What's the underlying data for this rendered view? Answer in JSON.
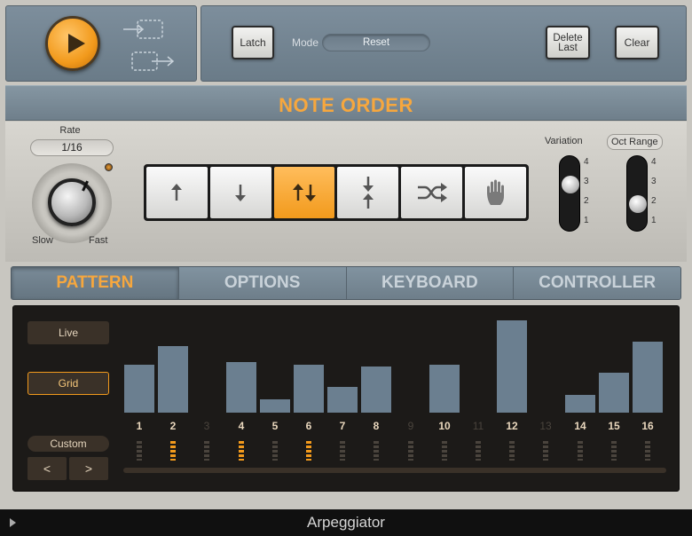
{
  "app": {
    "title": "Arpeggiator"
  },
  "transport": {
    "play_icon": "play-icon",
    "route_in_icon": "midi-in-icon",
    "route_out_icon": "midi-out-icon"
  },
  "controls": {
    "latch_label": "Latch",
    "mode_label": "Mode",
    "mode_value": "Reset",
    "delete_last_label": "Delete Last",
    "clear_label": "Clear"
  },
  "note_order": {
    "title": "NOTE ORDER",
    "rate_label": "Rate",
    "rate_value": "1/16",
    "slow_label": "Slow",
    "fast_label": "Fast",
    "directions": [
      {
        "name": "up",
        "icon": "arrow-up-icon",
        "active": false
      },
      {
        "name": "down",
        "icon": "arrow-down-icon",
        "active": false
      },
      {
        "name": "up-down",
        "icon": "arrow-up-down-icon",
        "active": true
      },
      {
        "name": "outside-in",
        "icon": "arrows-converge-icon",
        "active": false
      },
      {
        "name": "random",
        "icon": "shuffle-icon",
        "active": false
      },
      {
        "name": "as-played",
        "icon": "hand-icon",
        "active": false
      }
    ],
    "variation_label": "Variation",
    "variation_value": 3,
    "oct_range_label": "Oct Range",
    "oct_range_value": 2,
    "scale_ticks": [
      "4",
      "3",
      "2",
      "1"
    ]
  },
  "tabs": [
    {
      "label": "PATTERN",
      "active": true
    },
    {
      "label": "OPTIONS",
      "active": false
    },
    {
      "label": "KEYBOARD",
      "active": false
    },
    {
      "label": "CONTROLLER",
      "active": false
    }
  ],
  "pattern": {
    "live_label": "Live",
    "grid_label": "Grid",
    "custom_label": "Custom",
    "prev_label": "<",
    "next_label": ">",
    "steps": [
      {
        "num": "1",
        "active": true,
        "level": 0.52,
        "pip_on": false
      },
      {
        "num": "2",
        "active": true,
        "level": 0.72,
        "pip_on": true
      },
      {
        "num": "3",
        "active": false,
        "level": 0,
        "pip_on": false
      },
      {
        "num": "4",
        "active": true,
        "level": 0.55,
        "pip_on": true
      },
      {
        "num": "5",
        "active": true,
        "level": 0.14,
        "pip_on": false
      },
      {
        "num": "6",
        "active": true,
        "level": 0.52,
        "pip_on": true
      },
      {
        "num": "7",
        "active": true,
        "level": 0.28,
        "pip_on": false
      },
      {
        "num": "8",
        "active": true,
        "level": 0.5,
        "pip_on": false
      },
      {
        "num": "9",
        "active": false,
        "level": 0,
        "pip_on": false
      },
      {
        "num": "10",
        "active": true,
        "level": 0.52,
        "pip_on": false
      },
      {
        "num": "11",
        "active": false,
        "level": 0,
        "pip_on": false
      },
      {
        "num": "12",
        "active": true,
        "level": 1.0,
        "pip_on": false
      },
      {
        "num": "13",
        "active": false,
        "level": 0,
        "pip_on": false
      },
      {
        "num": "14",
        "active": true,
        "level": 0.19,
        "pip_on": false
      },
      {
        "num": "15",
        "active": true,
        "level": 0.43,
        "pip_on": false
      },
      {
        "num": "16",
        "active": true,
        "level": 0.77,
        "pip_on": false
      }
    ]
  },
  "colors": {
    "accent": "#f29a1c",
    "bar": "#6b7f90"
  }
}
